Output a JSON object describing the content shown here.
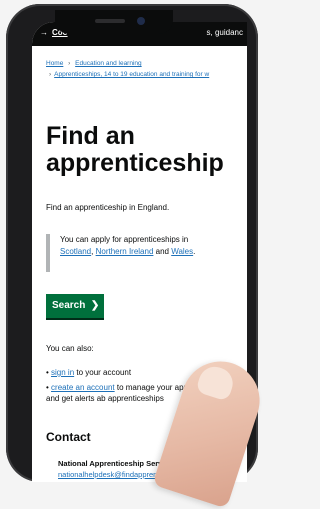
{
  "top_bar": {
    "arrow": "→",
    "cookie_text": "Coo",
    "right_text": "s, guidanc"
  },
  "breadcrumbs": [
    "Home",
    "Education and learning",
    "Apprenticeships, 14 to 19 education and training for w"
  ],
  "page": {
    "title_line1": "Find an",
    "title_line2": "apprenticeship",
    "lead": "Find an apprenticeship in England."
  },
  "inset": {
    "text": "You can apply for apprenticeships in",
    "links": [
      "Scotland",
      "Northern Ireland",
      "Wales"
    ],
    "join_comma": ", ",
    "join_and": " and ",
    "end": "."
  },
  "search_button": {
    "label": "Search",
    "icon": "chevron-right"
  },
  "also": {
    "heading": "You can also:",
    "items": [
      {
        "link": "sign in",
        "rest": " to your account"
      },
      {
        "link": "create an account",
        "rest": " to manage your applications and get alerts ab apprenticeships"
      }
    ]
  },
  "contact": {
    "heading": "Contact",
    "org": "National Apprenticeship Servic",
    "email": "nationalhelpdesk@findapprentices ce.gov.uk"
  },
  "colors": {
    "link": "#1d70b8",
    "button": "#00703c",
    "text": "#0b0c0c"
  }
}
